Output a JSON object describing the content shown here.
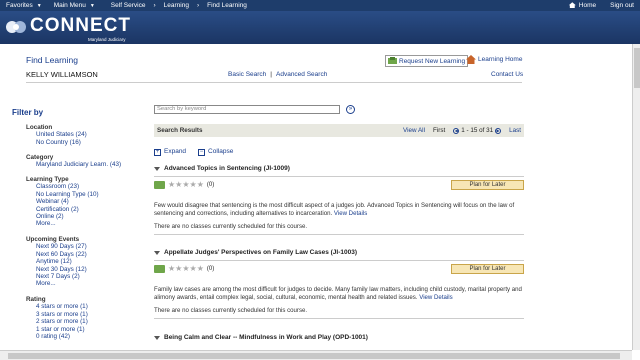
{
  "topnav": {
    "favorites": "Favorites",
    "main_menu": "Main Menu",
    "breadcrumb": [
      "Self Service",
      "Learning",
      "Find Learning"
    ],
    "home": "Home",
    "sign_out": "Sign out"
  },
  "brand": {
    "logo_text": "CONNECT",
    "subtitle": "Maryland Judiciary"
  },
  "header": {
    "title": "Find Learning",
    "user_name": "KELLY WILLIAMSON",
    "basic_search": "Basic Search",
    "separator": "|",
    "advanced_search": "Advanced Search",
    "request_new": "Request New Learning",
    "learning_home": "Learning Home",
    "contact_us": "Contact Us"
  },
  "filter": {
    "title": "Filter by",
    "groups": [
      {
        "heading": "Location",
        "items": [
          "United States (24)",
          "No Country (16)"
        ]
      },
      {
        "heading": "Category",
        "items": [
          "Maryland Judiciary Learn. (43)"
        ]
      },
      {
        "heading": "Learning Type",
        "items": [
          "Classroom (23)",
          "No Learning Type (10)",
          "Webinar (4)",
          "Certification (2)",
          "Online (2)",
          "More..."
        ]
      },
      {
        "heading": "Upcoming Events",
        "items": [
          "Next 90 Days (27)",
          "Next 60 Days (22)",
          "Anytime (12)",
          "Next 30 Days (12)",
          "Next 7 Days (2)",
          "More..."
        ]
      },
      {
        "heading": "Rating",
        "items": [
          "4 stars or more (1)",
          "3 stars or more (1)",
          "2 stars or more (1)",
          "1 star or more (1)",
          "0 rating (42)"
        ]
      }
    ]
  },
  "search": {
    "placeholder": "Search by keyword",
    "go": "»"
  },
  "results": {
    "label": "Search Results",
    "view_all": "View All",
    "first": "First",
    "range": "1 - 15 of 31",
    "last": "Last",
    "expand": "Expand",
    "collapse": "Collapse"
  },
  "courses": [
    {
      "title": "Advanced Topics in Sentencing (JI-1009)",
      "rating": "(0)",
      "plan_label": "Plan for Later",
      "description": "Few would disagree that sentencing is the most difficult aspect of a judges job. Advanced Topics in Sentencing will focus on the law of sentencing and corrections, including alternatives to incarceration.",
      "view_details": "View Details",
      "no_classes": "There are no classes currently scheduled for this course."
    },
    {
      "title": "Appellate Judges' Perspectives on Family Law Cases (JI-1003)",
      "rating": "(0)",
      "plan_label": "Plan for Later",
      "description": "Family law cases are among the most difficult for judges to decide. Many family law matters, including child custody, marital property and alimony awards, entail complex legal, social, cultural, economic, mental health and related issues.",
      "view_details": "View Details",
      "no_classes": "There are no classes currently scheduled for this course."
    },
    {
      "title": "Being Calm and Clear -- Mindfulness in Work and Play (OPD-1001)"
    }
  ]
}
